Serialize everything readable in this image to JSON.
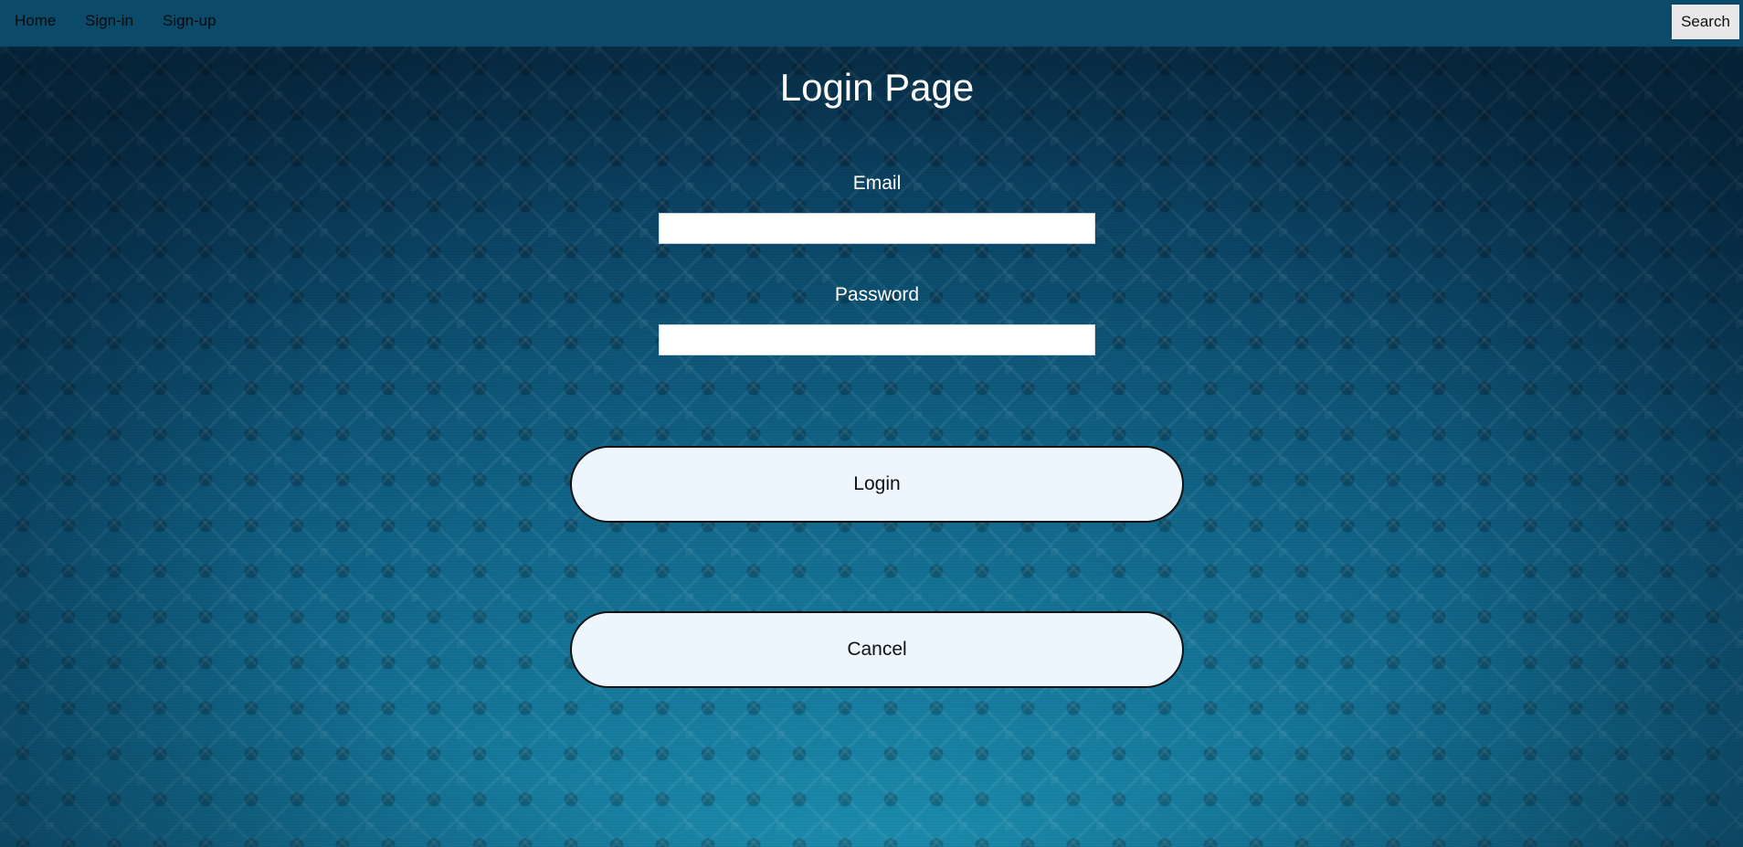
{
  "navbar": {
    "links": [
      {
        "label": "Home"
      },
      {
        "label": "Sign-in"
      },
      {
        "label": "Sign-up"
      }
    ],
    "search_label": "Search"
  },
  "main": {
    "title": "Login Page",
    "email_label": "Email",
    "email_value": "",
    "password_label": "Password",
    "password_value": "",
    "login_label": "Login",
    "cancel_label": "Cancel"
  },
  "colors": {
    "navbar": "#0b4a68",
    "background": "#167a9d",
    "button_fill": "#eef6fd"
  }
}
